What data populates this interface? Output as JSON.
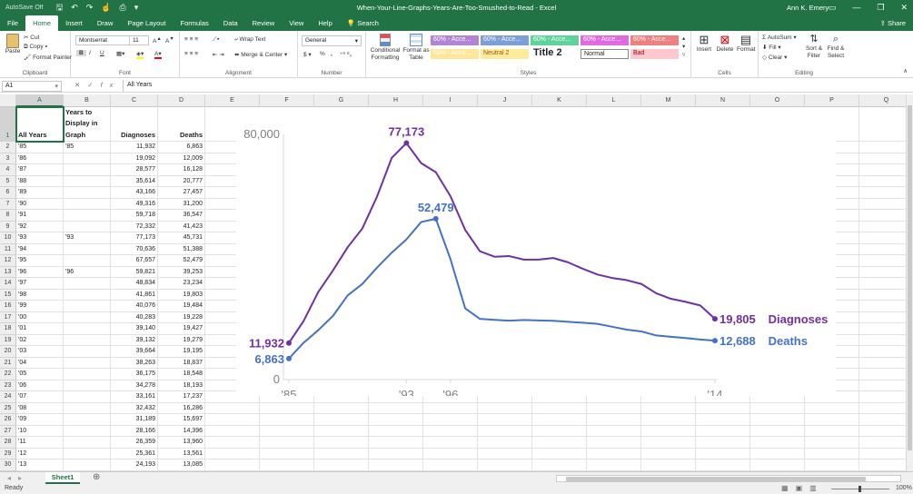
{
  "titlebar": {
    "autosave": "AutoSave",
    "autosave_state": "Off",
    "doc_title": "When-Your-Line-Graphs-Years-Are-Too-Smushed-to-Read  -  Excel",
    "user": "Ann K. Emery"
  },
  "tabs": [
    "File",
    "Home",
    "Insert",
    "Draw",
    "Page Layout",
    "Formulas",
    "Data",
    "Review",
    "View",
    "Help"
  ],
  "search_label": "Search",
  "share_label": "Share",
  "ribbon": {
    "clipboard": {
      "label": "Clipboard",
      "paste": "Paste",
      "cut": "Cut",
      "copy": "Copy",
      "format_painter": "Format Painter"
    },
    "font": {
      "label": "Font",
      "name": "Montserrat",
      "size": "11",
      "bold": "B",
      "italic": "I",
      "underline": "U"
    },
    "alignment": {
      "label": "Alignment",
      "wrap": "Wrap Text",
      "merge": "Merge & Center"
    },
    "number": {
      "label": "Number",
      "format": "General",
      "currency": "$",
      "percent": "%",
      "comma": ","
    },
    "styles": {
      "label": "Styles",
      "conditional": "Conditional Formatting",
      "format_table": "Format as Table",
      "cells": [
        {
          "text": "60% - Acce...",
          "bg": "#b284d6",
          "color": "#ffffff"
        },
        {
          "text": "60% - Acce...",
          "bg": "#7b9fd6",
          "color": "#ffffff"
        },
        {
          "text": "60% - Acce...",
          "bg": "#5ed39c",
          "color": "#ffffff"
        },
        {
          "text": "60% - Acce...",
          "bg": "#e06ae0",
          "color": "#ffffff"
        },
        {
          "text": "60% - Acce...",
          "bg": "#f08080",
          "color": "#ffffff"
        },
        {
          "text": "60% - Acce...",
          "bg": "#ffe699",
          "color": "#ffffff"
        },
        {
          "text": "Neutral 2",
          "bg": "#ffeb9c",
          "color": "#9c5700"
        },
        {
          "text": "Title 2",
          "bg": "#ffffff",
          "color": "#222222"
        },
        {
          "text": "Normal",
          "bg": "#ffffff",
          "color": "#222222"
        },
        {
          "text": "Bad",
          "bg": "#ffc7ce",
          "color": "#9c0006"
        }
      ]
    },
    "cells": {
      "label": "Cells",
      "insert": "Insert",
      "delete": "Delete",
      "format": "Format"
    },
    "editing": {
      "label": "Editing",
      "autosum": "AutoSum",
      "fill": "Fill",
      "clear": "Clear",
      "sort": "Sort & Filter",
      "find": "Find & Select"
    }
  },
  "formula_bar": {
    "name_box": "A1",
    "cancel": "✕",
    "enter": "✓",
    "fx": "fx",
    "value": "All Years"
  },
  "columns": [
    "A",
    "B",
    "C",
    "D",
    "E",
    "F",
    "G",
    "H",
    "I",
    "J",
    "K",
    "L",
    "M",
    "N",
    "O",
    "P",
    "Q"
  ],
  "header_row": {
    "a": "All Years",
    "b": "Years to Display in Graph",
    "c": "Diagnoses",
    "d": "Deaths"
  },
  "rows": [
    {
      "n": "2",
      "a": "'85",
      "b": "'85",
      "c": "11,932",
      "d": "6,863"
    },
    {
      "n": "3",
      "a": "'86",
      "b": "",
      "c": "19,092",
      "d": "12,009"
    },
    {
      "n": "4",
      "a": "'87",
      "b": "",
      "c": "28,577",
      "d": "16,128"
    },
    {
      "n": "5",
      "a": "'88",
      "b": "",
      "c": "35,614",
      "d": "20,777"
    },
    {
      "n": "6",
      "a": "'89",
      "b": "",
      "c": "43,166",
      "d": "27,457"
    },
    {
      "n": "7",
      "a": "'90",
      "b": "",
      "c": "49,316",
      "d": "31,200"
    },
    {
      "n": "8",
      "a": "'91",
      "b": "",
      "c": "59,718",
      "d": "36,547"
    },
    {
      "n": "9",
      "a": "'92",
      "b": "",
      "c": "72,332",
      "d": "41,423"
    },
    {
      "n": "10",
      "a": "'93",
      "b": "'93",
      "c": "77,173",
      "d": "45,731"
    },
    {
      "n": "11",
      "a": "'94",
      "b": "",
      "c": "70,636",
      "d": "51,388"
    },
    {
      "n": "12",
      "a": "'95",
      "b": "",
      "c": "67,657",
      "d": "52,479"
    },
    {
      "n": "13",
      "a": "'96",
      "b": "'96",
      "c": "59,821",
      "d": "39,253"
    },
    {
      "n": "14",
      "a": "'97",
      "b": "",
      "c": "48,834",
      "d": "23,234"
    },
    {
      "n": "15",
      "a": "'98",
      "b": "",
      "c": "41,861",
      "d": "19,803"
    },
    {
      "n": "16",
      "a": "'99",
      "b": "",
      "c": "40,076",
      "d": "19,484"
    },
    {
      "n": "17",
      "a": "'00",
      "b": "",
      "c": "40,283",
      "d": "19,228"
    },
    {
      "n": "18",
      "a": "'01",
      "b": "",
      "c": "39,140",
      "d": "19,427"
    },
    {
      "n": "19",
      "a": "'02",
      "b": "",
      "c": "39,132",
      "d": "19,279"
    },
    {
      "n": "20",
      "a": "'03",
      "b": "",
      "c": "39,664",
      "d": "19,195"
    },
    {
      "n": "21",
      "a": "'04",
      "b": "",
      "c": "38,263",
      "d": "18,837"
    },
    {
      "n": "22",
      "a": "'05",
      "b": "",
      "c": "36,175",
      "d": "18,548"
    },
    {
      "n": "23",
      "a": "'06",
      "b": "",
      "c": "34,278",
      "d": "18,193"
    },
    {
      "n": "24",
      "a": "'07",
      "b": "",
      "c": "33,161",
      "d": "17,237"
    },
    {
      "n": "25",
      "a": "'08",
      "b": "",
      "c": "32,432",
      "d": "16,286"
    },
    {
      "n": "26",
      "a": "'09",
      "b": "",
      "c": "31,189",
      "d": "15,697"
    },
    {
      "n": "27",
      "a": "'10",
      "b": "",
      "c": "28,166",
      "d": "14,396"
    },
    {
      "n": "28",
      "a": "'11",
      "b": "",
      "c": "26,359",
      "d": "13,960"
    },
    {
      "n": "29",
      "a": "'12",
      "b": "",
      "c": "25,361",
      "d": "13,561"
    },
    {
      "n": "30",
      "a": "'13",
      "b": "",
      "c": "24,193",
      "d": "13,085"
    }
  ],
  "chart_data": {
    "type": "line",
    "x": [
      "'85",
      "'86",
      "'87",
      "'88",
      "'89",
      "'90",
      "'91",
      "'92",
      "'93",
      "'94",
      "'95",
      "'96",
      "'97",
      "'98",
      "'99",
      "'00",
      "'01",
      "'02",
      "'03",
      "'04",
      "'05",
      "'06",
      "'07",
      "'08",
      "'09",
      "'10",
      "'11",
      "'12",
      "'13",
      "'14"
    ],
    "x_tick_labels": [
      "'85",
      "'93",
      "'96",
      "'14"
    ],
    "y_tick_labels": [
      "80,000",
      "0"
    ],
    "ylim": [
      0,
      80000
    ],
    "grid": false,
    "legend": "none",
    "series": [
      {
        "name": "Diagnoses",
        "color": "#7030a0",
        "values": [
          11932,
          19092,
          28577,
          35614,
          43166,
          49316,
          59718,
          72332,
          77173,
          70636,
          67657,
          59821,
          48834,
          41861,
          40076,
          40283,
          39140,
          39132,
          39664,
          38263,
          36175,
          34278,
          33161,
          32432,
          31189,
          28166,
          26359,
          25361,
          24193,
          19805
        ],
        "labels": [
          {
            "i": 0,
            "text": "11,932"
          },
          {
            "i": 8,
            "text": "77,173"
          },
          {
            "i": 29,
            "text": "19,805"
          }
        ],
        "end_label": "Diagnoses"
      },
      {
        "name": "Deaths",
        "color": "#4472c4",
        "values": [
          6863,
          12009,
          16128,
          20777,
          27457,
          31200,
          36547,
          41423,
          45731,
          51388,
          52479,
          39253,
          23234,
          19803,
          19484,
          19228,
          19427,
          19279,
          19195,
          18837,
          18548,
          18193,
          17237,
          16286,
          15697,
          14396,
          13960,
          13561,
          13085,
          12688
        ],
        "labels": [
          {
            "i": 0,
            "text": "6,863"
          },
          {
            "i": 10,
            "text": "52,479"
          },
          {
            "i": 29,
            "text": "12,688"
          }
        ],
        "end_label": "Deaths"
      }
    ]
  },
  "sheet_tab": "Sheet1",
  "status": {
    "ready": "Ready",
    "zoom": "100%"
  }
}
